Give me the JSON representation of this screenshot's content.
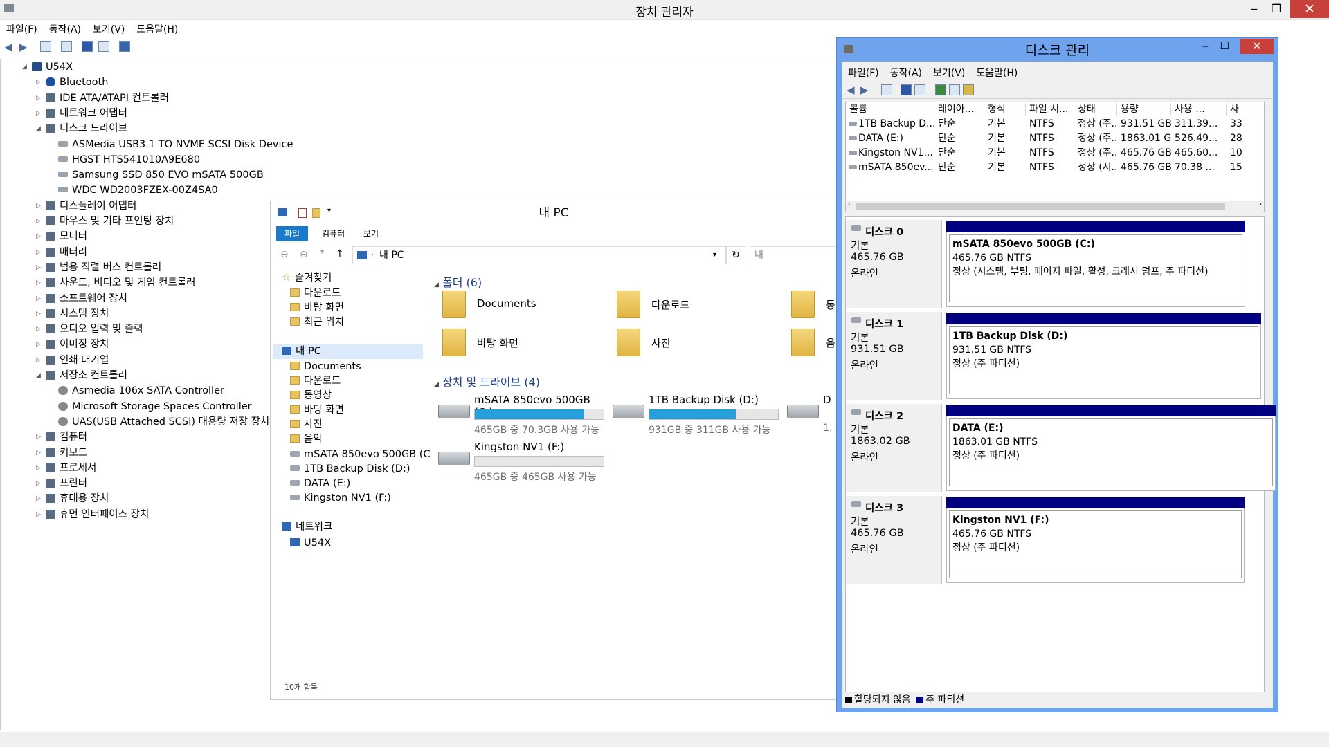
{
  "device_manager": {
    "title": "장치 관리자",
    "menu": [
      "파일(F)",
      "동작(A)",
      "보기(V)",
      "도움말(H)"
    ],
    "tree": [
      {
        "label": "U54X",
        "level": 0,
        "expanded": "◢"
      },
      {
        "label": "Bluetooth",
        "level": 1,
        "expanded": "▷"
      },
      {
        "label": "IDE ATA/ATAPI 컨트롤러",
        "level": 1,
        "expanded": "▷"
      },
      {
        "label": "네트워크 어댑터",
        "level": 1,
        "expanded": "▷"
      },
      {
        "label": "디스크 드라이브",
        "level": 1,
        "expanded": "◢"
      },
      {
        "label": "ASMedia USB3.1 TO NVME SCSI Disk Device",
        "level": 2
      },
      {
        "label": "HGST HTS541010A9E680",
        "level": 2
      },
      {
        "label": "Samsung SSD 850 EVO mSATA 500GB",
        "level": 2
      },
      {
        "label": "WDC WD2003FZEX-00Z4SA0",
        "level": 2
      },
      {
        "label": "디스플레이 어댑터",
        "level": 1,
        "expanded": "▷"
      },
      {
        "label": "마우스 및 기타 포인팅 장치",
        "level": 1,
        "expanded": "▷"
      },
      {
        "label": "모니터",
        "level": 1,
        "expanded": "▷"
      },
      {
        "label": "배터리",
        "level": 1,
        "expanded": "▷"
      },
      {
        "label": "범용 직렬 버스 컨트롤러",
        "level": 1,
        "expanded": "▷"
      },
      {
        "label": "사운드, 비디오 및 게임 컨트롤러",
        "level": 1,
        "expanded": "▷"
      },
      {
        "label": "소프트웨어 장치",
        "level": 1,
        "expanded": "▷"
      },
      {
        "label": "시스템 장치",
        "level": 1,
        "expanded": "▷"
      },
      {
        "label": "오디오 입력 및 출력",
        "level": 1,
        "expanded": "▷"
      },
      {
        "label": "이미징 장치",
        "level": 1,
        "expanded": "▷"
      },
      {
        "label": "인쇄 대기열",
        "level": 1,
        "expanded": "▷"
      },
      {
        "label": "저장소 컨트롤러",
        "level": 1,
        "expanded": "◢"
      },
      {
        "label": "Asmedia 106x SATA Controller",
        "level": 2
      },
      {
        "label": "Microsoft Storage Spaces Controller",
        "level": 2
      },
      {
        "label": "UAS(USB Attached SCSI) 대용량 저장 장치",
        "level": 2
      },
      {
        "label": "컴퓨터",
        "level": 1,
        "expanded": "▷"
      },
      {
        "label": "키보드",
        "level": 1,
        "expanded": "▷"
      },
      {
        "label": "프로세서",
        "level": 1,
        "expanded": "▷"
      },
      {
        "label": "프린터",
        "level": 1,
        "expanded": "▷"
      },
      {
        "label": "휴대용 장치",
        "level": 1,
        "expanded": "▷"
      },
      {
        "label": "휴먼 인터페이스 장치",
        "level": 1,
        "expanded": "▷"
      }
    ]
  },
  "explorer": {
    "title": "내 PC",
    "tabs": [
      "파일",
      "컴퓨터",
      "보기"
    ],
    "address": "내 PC",
    "address_cut": "내",
    "nav": [
      {
        "label": "즐겨찾기",
        "type": "star"
      },
      {
        "label": "다운로드",
        "type": "folder"
      },
      {
        "label": "바탕 화면",
        "type": "folder"
      },
      {
        "label": "최근 위치",
        "type": "folder"
      },
      {
        "label": "내 PC",
        "type": "pc"
      },
      {
        "label": "Documents",
        "type": "folder"
      },
      {
        "label": "다운로드",
        "type": "folder"
      },
      {
        "label": "동영상",
        "type": "folder"
      },
      {
        "label": "바탕 화면",
        "type": "folder"
      },
      {
        "label": "사진",
        "type": "folder"
      },
      {
        "label": "음악",
        "type": "folder"
      },
      {
        "label": "mSATA 850evo 500GB (C",
        "type": "drive"
      },
      {
        "label": "1TB Backup Disk (D:)",
        "type": "drive"
      },
      {
        "label": "DATA (E:)",
        "type": "drive"
      },
      {
        "label": "Kingston NV1 (F:)",
        "type": "drive"
      },
      {
        "label": "네트워크",
        "type": "net"
      },
      {
        "label": "U54X",
        "type": "pc"
      }
    ],
    "folders_header": "폴더 (6)",
    "folders": [
      "Documents",
      "다운로드",
      "동",
      "바탕 화면",
      "사진",
      "음"
    ],
    "drives_header": "장치 및 드라이브 (4)",
    "drives": [
      {
        "name": "mSATA 850evo 500GB (C:)",
        "free": "465GB 중 70.3GB 사용 가능",
        "used_fraction": 0.85
      },
      {
        "name": "1TB Backup Disk (D:)",
        "free": "931GB 중 311GB 사용 가능",
        "used_fraction": 0.67
      },
      {
        "name": "D",
        "free": "1.",
        "used_fraction": 0
      },
      {
        "name": "Kingston NV1 (F:)",
        "free": "465GB 중 465GB 사용 가능",
        "used_fraction": 0.0
      }
    ],
    "status": "10개 항목"
  },
  "disk_mgmt": {
    "title": "디스크 관리",
    "menu": [
      "파일(F)",
      "동작(A)",
      "보기(V)",
      "도움말(H)"
    ],
    "columns": [
      "볼륨",
      "레이아...",
      "형식",
      "파일 시...",
      "상태",
      "용량",
      "사용 ...",
      "사"
    ],
    "volumes": [
      [
        "1TB Backup D...",
        "단순",
        "기본",
        "NTFS",
        "정상 (주...",
        "931.51 GB",
        "311.39...",
        "33"
      ],
      [
        "DATA (E:)",
        "단순",
        "기본",
        "NTFS",
        "정상 (주...",
        "1863.01 GB",
        "526.49...",
        "28"
      ],
      [
        "Kingston NV1...",
        "단순",
        "기본",
        "NTFS",
        "정상 (주...",
        "465.76 GB",
        "465.60...",
        "10"
      ],
      [
        "mSATA 850ev...",
        "단순",
        "기본",
        "NTFS",
        "정상 (시...",
        "465.76 GB",
        "70.38 ...",
        "15"
      ]
    ],
    "disks": [
      {
        "name": "디스크 0",
        "type": "기본",
        "size": "465.76 GB",
        "state": "온라인",
        "part_name": "mSATA 850evo 500GB  (C:)",
        "part_size": "465.76 GB NTFS",
        "part_status": "정상 (시스템, 부팅, 페이지 파일, 활성, 크래시 덤프, 주 파티션)"
      },
      {
        "name": "디스크 1",
        "type": "기본",
        "size": "931.51 GB",
        "state": "온라인",
        "part_name": "1TB Backup Disk  (D:)",
        "part_size": "931.51 GB NTFS",
        "part_status": "정상 (주 파티션)"
      },
      {
        "name": "디스크 2",
        "type": "기본",
        "size": "1863.02 GB",
        "state": "온라인",
        "part_name": "DATA  (E:)",
        "part_size": "1863.01 GB NTFS",
        "part_status": "정상 (주 파티션)"
      },
      {
        "name": "디스크 3",
        "type": "기본",
        "size": "465.76 GB",
        "state": "온라인",
        "part_name": "Kingston NV1  (F:)",
        "part_size": "465.76 GB NTFS",
        "part_status": "정상 (주 파티션)"
      }
    ],
    "legend": [
      "할당되지 않음",
      "주 파티션"
    ],
    "colors": {
      "unallocated": "#000000",
      "primary": "#000080"
    }
  }
}
